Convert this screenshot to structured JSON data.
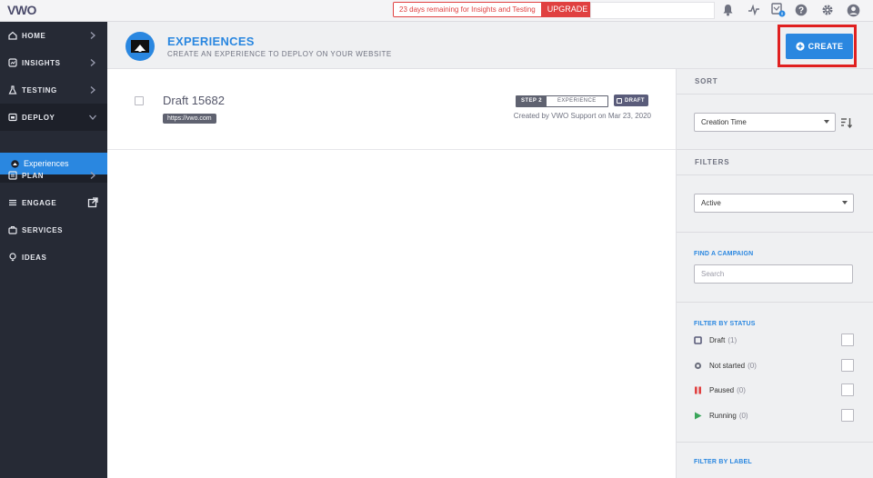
{
  "topbar": {
    "logo_text": "VWO",
    "trial_message": "23 days remaining for Insights and Testing",
    "upgrade_label": "UPGRADE",
    "icons": [
      "bell-icon",
      "activity-icon",
      "integrations-icon",
      "help-icon",
      "settings-icon",
      "account-icon"
    ]
  },
  "sidebar": {
    "items": [
      {
        "label": "HOME",
        "icon": "home-icon"
      },
      {
        "label": "INSIGHTS",
        "icon": "insights-icon"
      },
      {
        "label": "TESTING",
        "icon": "flask-icon"
      },
      {
        "label": "DEPLOY",
        "icon": "deploy-icon"
      },
      {
        "label": "PLAN",
        "icon": "plan-icon"
      },
      {
        "label": "ENGAGE",
        "icon": "engage-icon"
      },
      {
        "label": "SERVICES",
        "icon": "briefcase-icon"
      },
      {
        "label": "IDEAS",
        "icon": "bulb-icon"
      }
    ],
    "active_sub_item": "Experiences"
  },
  "header": {
    "title": "EXPERIENCES",
    "subtitle": "CREATE AN EXPERIENCE TO DEPLOY ON YOUR WEBSITE",
    "create_label": "CREATE"
  },
  "campaigns": [
    {
      "name": "Draft 15682",
      "url": "https://vwo.com",
      "step_label": "STEP 2",
      "step_name": "EXPERIENCE",
      "status": "DRAFT",
      "created": "Created by VWO Support on Mar 23, 2020"
    }
  ],
  "panel": {
    "sort_heading": "SORT",
    "sort_value": "Creation Time",
    "filters_heading": "FILTERS",
    "filter_value": "Active",
    "find_label": "FIND A CAMPAIGN",
    "search_placeholder": "Search",
    "status_label": "FILTER BY STATUS",
    "statuses": [
      {
        "name": "Draft",
        "count": "(1)"
      },
      {
        "name": "Not started",
        "count": "(0)"
      },
      {
        "name": "Paused",
        "count": "(0)"
      },
      {
        "name": "Running",
        "count": "(0)"
      }
    ],
    "label_filter": "FILTER BY LABEL"
  },
  "colors": {
    "accent": "#2a87e0",
    "sidebar": "#262a35",
    "highlight_border": "#e02020",
    "upgrade": "#e04040"
  }
}
